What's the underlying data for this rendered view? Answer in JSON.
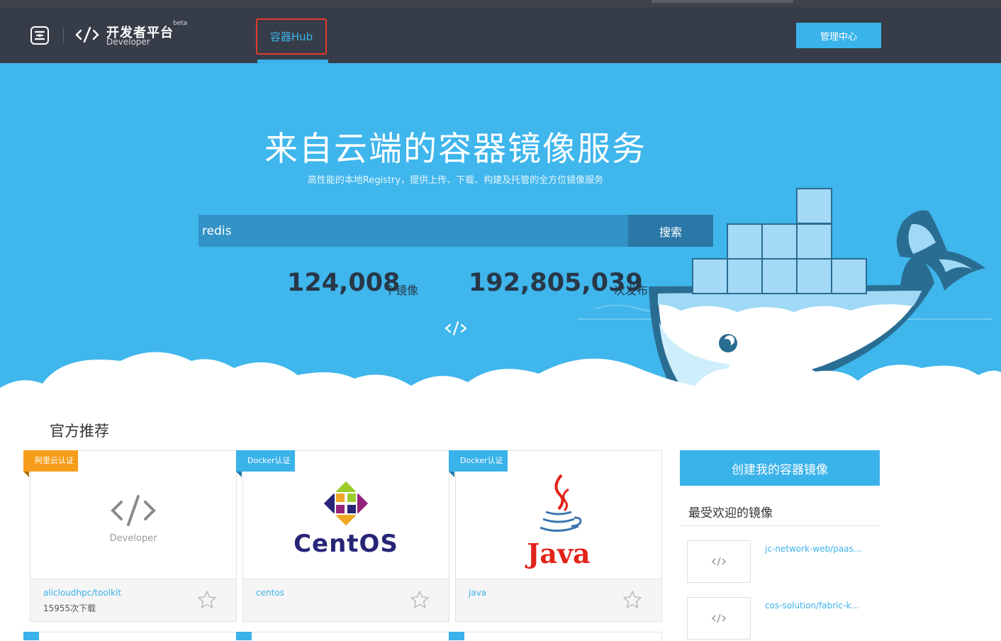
{
  "header": {
    "brand_title": "开发者平台",
    "brand_sub": "Developer",
    "brand_beta": "beta",
    "nav_hub": "容器Hub",
    "manage_button": "管理中心"
  },
  "hero": {
    "title": "来自云端的容器镜像服务",
    "subtitle": "高性能的本地Registry，提供上传、下载、构建及托管的全方位镜像服务",
    "search_value": "redis",
    "search_button": "搜索",
    "stats": {
      "images_count": "124,008",
      "images_unit": "个镜像",
      "publish_count": "192,805,039",
      "publish_unit": "次发布"
    }
  },
  "recommended": {
    "title": "官方推荐",
    "cards": [
      {
        "badge": "阿里云认证",
        "badge_color": "#f59d1a",
        "logo": "developer-icon",
        "logo_text": "Developer",
        "name": "alicloudhpc/toolkit",
        "downloads": "15955次下载"
      },
      {
        "badge": "Docker认证",
        "badge_color": "#3ab2ea",
        "logo": "centos-icon",
        "logo_text": "CentOS",
        "name": "centos"
      },
      {
        "badge": "Docker认证",
        "badge_color": "#3ab2ea",
        "logo": "java-icon",
        "logo_text": "Java",
        "name": "java"
      }
    ]
  },
  "sidebar": {
    "create_button": "创建我的容器镜像",
    "popular_title": "最受欢迎的镜像",
    "popular": [
      {
        "name": "jc-network-web/paas..."
      },
      {
        "name": "cos-solution/fabric-k..."
      }
    ]
  }
}
